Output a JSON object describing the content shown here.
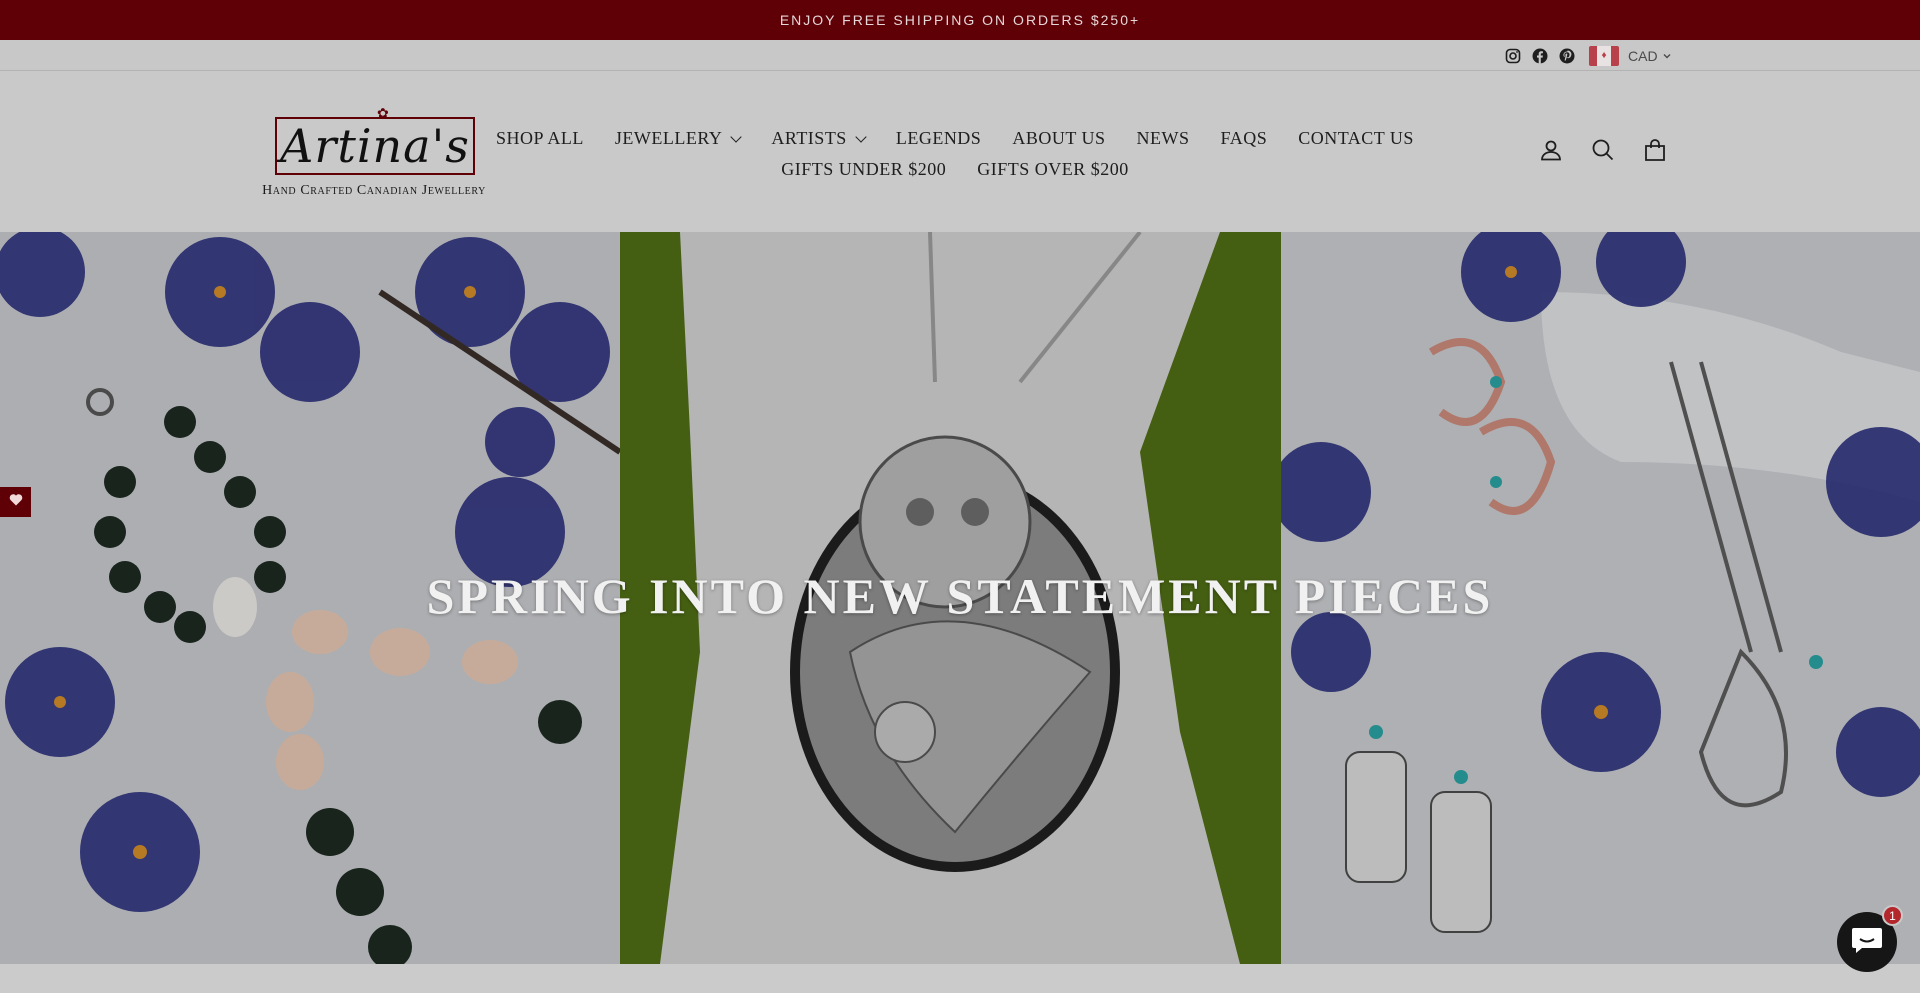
{
  "announcement": {
    "text": "ENJOY FREE SHIPPING ON ORDERS $250+"
  },
  "utility": {
    "social_icons": [
      "instagram-icon",
      "facebook-icon",
      "pinterest-icon"
    ],
    "currency": "CAD"
  },
  "logo": {
    "name": "Artina's",
    "tagline": "Hand Crafted Canadian Jewellery"
  },
  "nav": {
    "row1": [
      {
        "label": "SHOP ALL",
        "dropdown": false
      },
      {
        "label": "JEWELLERY",
        "dropdown": true
      },
      {
        "label": "ARTISTS",
        "dropdown": true
      },
      {
        "label": "LEGENDS",
        "dropdown": false
      },
      {
        "label": "ABOUT US",
        "dropdown": false
      },
      {
        "label": "NEWS",
        "dropdown": false
      },
      {
        "label": "FAQS",
        "dropdown": false
      },
      {
        "label": "CONTACT US",
        "dropdown": false
      }
    ],
    "row2": [
      {
        "label": "GIFTS UNDER $200",
        "dropdown": false
      },
      {
        "label": "GIFTS OVER $200",
        "dropdown": false
      }
    ]
  },
  "header_icons": [
    "account-icon",
    "search-icon",
    "cart-icon"
  ],
  "hero": {
    "title": "SPRING INTO NEW STATEMENT PIECES"
  },
  "chat": {
    "badge": "1"
  },
  "colors": {
    "brand": "#5e0006",
    "accent": "#b3282d"
  }
}
